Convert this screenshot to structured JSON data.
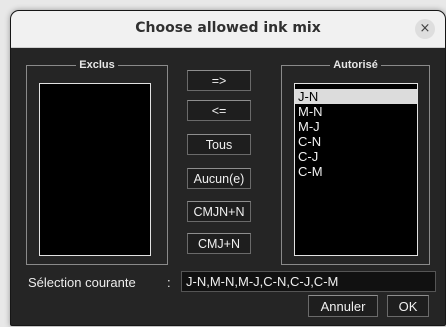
{
  "window": {
    "title": "Choose allowed ink mix",
    "close_glyph": "×"
  },
  "excluded": {
    "legend": "Exclus",
    "items": []
  },
  "allowed": {
    "legend": "Autorisé",
    "items": [
      {
        "label": "J-N",
        "selected": true
      },
      {
        "label": "M-N",
        "selected": false
      },
      {
        "label": "M-J",
        "selected": false
      },
      {
        "label": "C-N",
        "selected": false
      },
      {
        "label": "C-J",
        "selected": false
      },
      {
        "label": "C-M",
        "selected": false
      }
    ]
  },
  "buttons": {
    "move_right": "=>",
    "move_left": "<=",
    "all": "Tous",
    "none": "Aucun(e)",
    "cmjn_n": "CMJN+N",
    "cmj_n": "CMJ+N"
  },
  "selection": {
    "label": "Sélection courante",
    "separator": ":",
    "value": "J-N,M-N,M-J,C-N,C-J,C-M"
  },
  "actions": {
    "cancel": "Annuler",
    "ok": "OK"
  }
}
